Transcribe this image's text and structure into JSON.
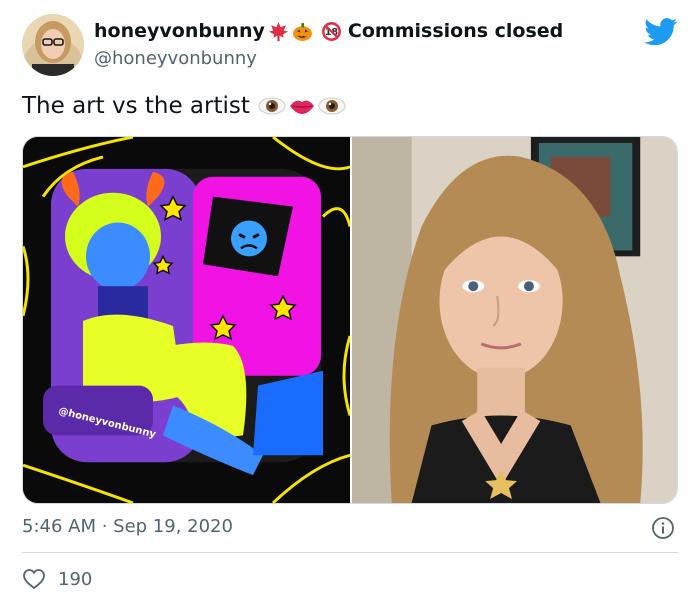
{
  "tweet": {
    "display_name": "honeyvonbunny",
    "name_emojis": [
      "maple-leaf",
      "jack-o-lantern"
    ],
    "status_badge": "18",
    "status_text": "Commissions closed",
    "handle": "@honeyvonbunny",
    "text": "The art vs the artist",
    "text_emojis": [
      "eye",
      "lips",
      "eye"
    ],
    "watermark": "@honeyvonbunny",
    "timestamp": "5:46 AM · Sep 19, 2020",
    "like_count": "190"
  },
  "icons": {
    "brand": "twitter-bird-icon",
    "info": "info-icon",
    "like": "heart-icon"
  },
  "colors": {
    "twitter_blue": "#1d9bf0",
    "secondary_text": "#536471",
    "border": "#cfd9de"
  }
}
